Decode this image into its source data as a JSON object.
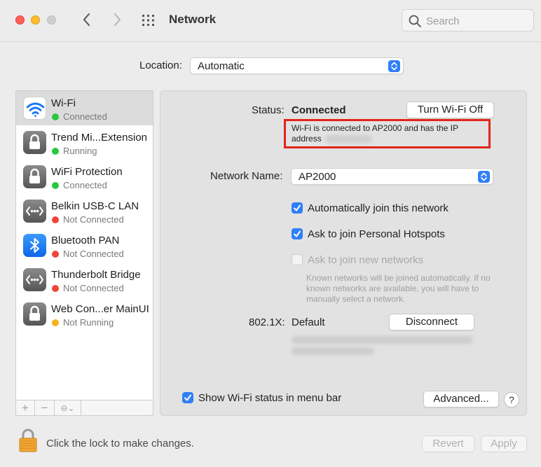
{
  "window": {
    "title": "Network"
  },
  "search": {
    "placeholder": "Search"
  },
  "location": {
    "label": "Location:",
    "value": "Automatic"
  },
  "services": [
    {
      "name": "Wi-Fi",
      "status": "Connected",
      "status_color": "#27c93f",
      "icon": "wifi-icon",
      "selected": true
    },
    {
      "name": "Trend Mi...Extension",
      "status": "Running",
      "status_color": "#27c93f",
      "icon": "lock-icon"
    },
    {
      "name": "WiFi Protection",
      "status": "Connected",
      "status_color": "#27c93f",
      "icon": "lock-icon"
    },
    {
      "name": "Belkin USB-C LAN",
      "status": "Not Connected",
      "status_color": "#f0453a",
      "icon": "ethernet-icon"
    },
    {
      "name": "Bluetooth PAN",
      "status": "Not Connected",
      "status_color": "#f0453a",
      "icon": "bluetooth-icon"
    },
    {
      "name": "Thunderbolt Bridge",
      "status": "Not Connected",
      "status_color": "#f0453a",
      "icon": "ethernet-icon"
    },
    {
      "name": "Web Con...er MainUI",
      "status": "Not Running",
      "status_color": "#f5b21f",
      "icon": "lock-icon"
    }
  ],
  "sidebar_tools": {
    "add": "+",
    "remove": "−",
    "action": "⊖⌄"
  },
  "detail": {
    "status_label": "Status:",
    "status_value": "Connected",
    "turn_off_button": "Turn Wi-Fi Off",
    "status_description": "Wi-Fi is connected to AP2000 and has the IP address",
    "network_name_label": "Network Name:",
    "network_name_value": "AP2000",
    "auto_join_label": "Automatically join this network",
    "auto_join_checked": true,
    "hotspots_label": "Ask to join Personal Hotspots",
    "hotspots_checked": true,
    "ask_new_label": "Ask to join new networks",
    "ask_new_checked": false,
    "known_networks_note": "Known networks will be joined automatically. If no known networks are available, you will have to manually select a network.",
    "x8021_label": "802.1X:",
    "x8021_value": "Default",
    "disconnect_button": "Disconnect",
    "show_status_label": "Show Wi-Fi status in menu bar",
    "show_status_checked": true,
    "advanced_button": "Advanced...",
    "help_button": "?"
  },
  "footer": {
    "lock_text": "Click the lock to make changes.",
    "revert_button": "Revert",
    "apply_button": "Apply"
  },
  "colors": {
    "accent": "#2f7ff7",
    "highlight_border": "#e3241b"
  }
}
